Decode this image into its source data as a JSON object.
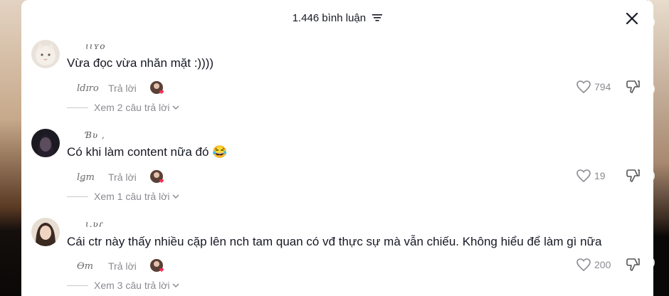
{
  "header": {
    "title": "1.446 bình luận"
  },
  "comments": [
    {
      "username": "ɩɩʏo",
      "text": "Vừa đọc vừa nhăn mặt :))))",
      "date": "ldɪro",
      "reply_label": "Trả lời",
      "likes": "794",
      "more_replies": "Xem 2 câu trả lời"
    },
    {
      "username": "Ɓʋ ,",
      "text": "Có khi làm content nữa đó 😂",
      "date": "lǥm",
      "reply_label": "Trả lời",
      "likes": "19",
      "more_replies": "Xem 1 câu trả lời"
    },
    {
      "username": "ɩ.ʋɾ",
      "text": "Cái ctr này thấy nhiều cặp lên nch tam quan có vđ thực sự mà vẫn chiếu. Không hiểu để làm gì nữa",
      "date": "Ɵm",
      "reply_label": "Trả lời",
      "likes": "200",
      "more_replies": "Xem 3 câu trả lời"
    }
  ]
}
